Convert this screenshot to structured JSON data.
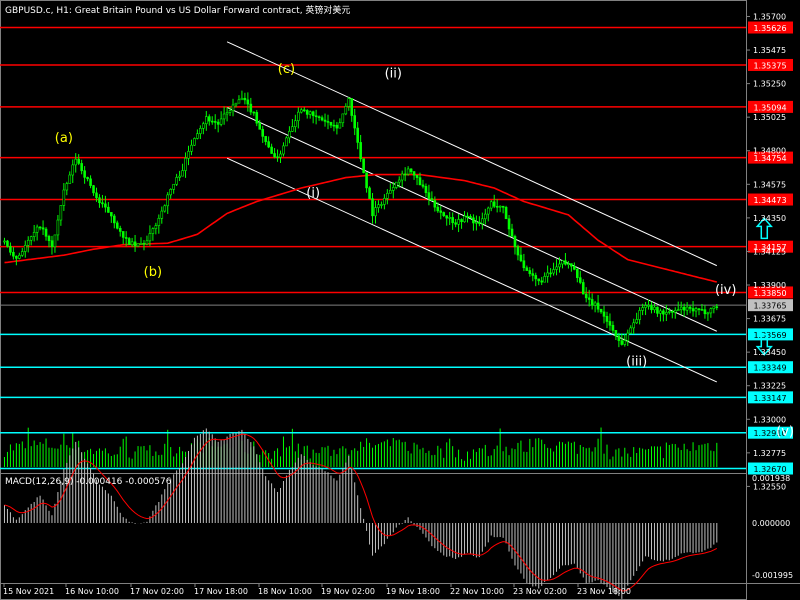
{
  "header": {
    "title": "GBPUSD.c, H1:  Great Britain Pound vs US Dollar Forward contract, 英镑对美元"
  },
  "macd": {
    "label": "MACD(12,26,9) -0.000416 -0.000576",
    "axis_labels": [
      "0.001938",
      "0.000000",
      "-0.001995"
    ]
  },
  "colors": {
    "background": "#000000",
    "candle": "#00ff00",
    "ma": "#ff0000",
    "resistance": "#ff0000",
    "support": "#00ffff",
    "channel": "#ffffff",
    "wave_yellow": "#ffff00",
    "wave_white": "#ffffff",
    "volume": "#00ff00",
    "macd_hist": "#c0c0c0",
    "macd_signal": "#ff0000"
  },
  "chart_data": {
    "type": "candlestick",
    "symbol": "GBPUSD.c",
    "timeframe": "H1",
    "ylim": [
      1.3266,
      1.3573
    ],
    "y_ticks": [
      "1.35700",
      "1.35475",
      "1.35250",
      "1.35025",
      "1.34800",
      "1.34575",
      "1.34350",
      "1.34125",
      "1.33900",
      "1.33675",
      "1.33450",
      "1.33225",
      "1.33000",
      "1.32775",
      "1.32550"
    ],
    "x_ticks": [
      "15 Nov 2021",
      "16 Nov 10:00",
      "17 Nov 02:00",
      "17 Nov 18:00",
      "18 Nov 10:00",
      "19 Nov 02:00",
      "19 Nov 18:00",
      "22 Nov 10:00",
      "23 Nov 02:00",
      "23 Nov 18:00"
    ],
    "current_price": {
      "label": "1.33765",
      "value": 1.33765
    },
    "resistance_levels": [
      {
        "label": "1.35626",
        "value": 1.35626
      },
      {
        "label": "1.35375",
        "value": 1.35375
      },
      {
        "label": "1.35094",
        "value": 1.35094
      },
      {
        "label": "1.34754",
        "value": 1.34754
      },
      {
        "label": "1.34473",
        "value": 1.34473
      },
      {
        "label": "1.34157",
        "value": 1.34157
      },
      {
        "label": "1.33850",
        "value": 1.3385
      }
    ],
    "support_levels": [
      {
        "label": "1.33569",
        "value": 1.33569
      },
      {
        "label": "1.33349",
        "value": 1.33349
      },
      {
        "label": "1.33147",
        "value": 1.33147
      },
      {
        "label": "1.32910",
        "value": 1.3291
      },
      {
        "label": "1.32670",
        "value": 1.3267
      }
    ],
    "close_path": [
      [
        0,
        1.3419
      ],
      [
        4,
        1.3408
      ],
      [
        8,
        1.3419
      ],
      [
        12,
        1.343
      ],
      [
        16,
        1.3415
      ],
      [
        20,
        1.3452
      ],
      [
        24,
        1.3475
      ],
      [
        28,
        1.346
      ],
      [
        32,
        1.3445
      ],
      [
        36,
        1.3437
      ],
      [
        40,
        1.3421
      ],
      [
        44,
        1.3416
      ],
      [
        48,
        1.3419
      ],
      [
        52,
        1.3435
      ],
      [
        56,
        1.3454
      ],
      [
        60,
        1.3468
      ],
      [
        64,
        1.349
      ],
      [
        68,
        1.3502
      ],
      [
        72,
        1.3498
      ],
      [
        76,
        1.3508
      ],
      [
        80,
        1.3515
      ],
      [
        84,
        1.3505
      ],
      [
        88,
        1.3485
      ],
      [
        92,
        1.3474
      ],
      [
        96,
        1.3494
      ],
      [
        100,
        1.3509
      ],
      [
        104,
        1.3503
      ],
      [
        108,
        1.35
      ],
      [
        112,
        1.3494
      ],
      [
        116,
        1.3515
      ],
      [
        120,
        1.3475
      ],
      [
        124,
        1.3438
      ],
      [
        128,
        1.3448
      ],
      [
        132,
        1.346
      ],
      [
        136,
        1.3468
      ],
      [
        140,
        1.3458
      ],
      [
        144,
        1.3445
      ],
      [
        148,
        1.3437
      ],
      [
        152,
        1.3432
      ],
      [
        156,
        1.3436
      ],
      [
        160,
        1.343
      ],
      [
        164,
        1.3445
      ],
      [
        168,
        1.3441
      ],
      [
        172,
        1.3416
      ],
      [
        176,
        1.3398
      ],
      [
        180,
        1.3392
      ],
      [
        184,
        1.3398
      ],
      [
        188,
        1.3405
      ],
      [
        192,
        1.3402
      ],
      [
        196,
        1.338
      ],
      [
        200,
        1.3375
      ],
      [
        204,
        1.3363
      ],
      [
        208,
        1.335
      ],
      [
        212,
        1.3365
      ],
      [
        216,
        1.3378
      ],
      [
        220,
        1.3372
      ],
      [
        224,
        1.3371
      ],
      [
        228,
        1.3374
      ],
      [
        232,
        1.3373
      ],
      [
        236,
        1.3372
      ],
      [
        240,
        1.3376
      ]
    ],
    "ma_path": [
      [
        0,
        1.3405
      ],
      [
        20,
        1.341
      ],
      [
        30,
        1.3414
      ],
      [
        40,
        1.3417
      ],
      [
        55,
        1.3418
      ],
      [
        65,
        1.3424
      ],
      [
        75,
        1.3438
      ],
      [
        85,
        1.3446
      ],
      [
        100,
        1.3455
      ],
      [
        115,
        1.3462
      ],
      [
        125,
        1.3464
      ],
      [
        140,
        1.3464
      ],
      [
        155,
        1.346
      ],
      [
        165,
        1.3455
      ],
      [
        175,
        1.3446
      ],
      [
        190,
        1.3437
      ],
      [
        200,
        1.342
      ],
      [
        210,
        1.3407
      ],
      [
        220,
        1.3402
      ],
      [
        232,
        1.3396
      ],
      [
        240,
        1.3392
      ]
    ],
    "channel_lines": [
      {
        "name": "upper",
        "from": [
          75,
          1.3553
        ],
        "to": [
          240,
          1.3403
        ]
      },
      {
        "name": "middle",
        "from": [
          75,
          1.3509
        ],
        "to": [
          240,
          1.3359
        ]
      },
      {
        "name": "lower",
        "from": [
          75,
          1.3475
        ],
        "to": [
          240,
          1.3325
        ]
      }
    ],
    "wave_labels": [
      {
        "text": "(a)",
        "x": 20,
        "y": 1.3486,
        "color": "yellow"
      },
      {
        "text": "(b)",
        "x": 50,
        "y": 1.3396,
        "color": "yellow"
      },
      {
        "text": "(c)",
        "x": 95,
        "y": 1.3532,
        "color": "yellow"
      },
      {
        "text": "(i)",
        "x": 104,
        "y": 1.3449,
        "color": "white"
      },
      {
        "text": "(ii)",
        "x": 131,
        "y": 1.3529,
        "color": "white"
      },
      {
        "text": "(iii)",
        "x": 213,
        "y": 1.3336,
        "color": "white"
      },
      {
        "text": "(iv)",
        "x": 243,
        "y": 1.3384,
        "color": "white"
      },
      {
        "text": "(v)",
        "x": 263,
        "y": 1.3289,
        "color": "white"
      }
    ],
    "arrows": [
      {
        "direction": "up",
        "x": 256,
        "y": 1.3428
      },
      {
        "direction": "down",
        "x": 256,
        "y": 1.335
      }
    ]
  }
}
